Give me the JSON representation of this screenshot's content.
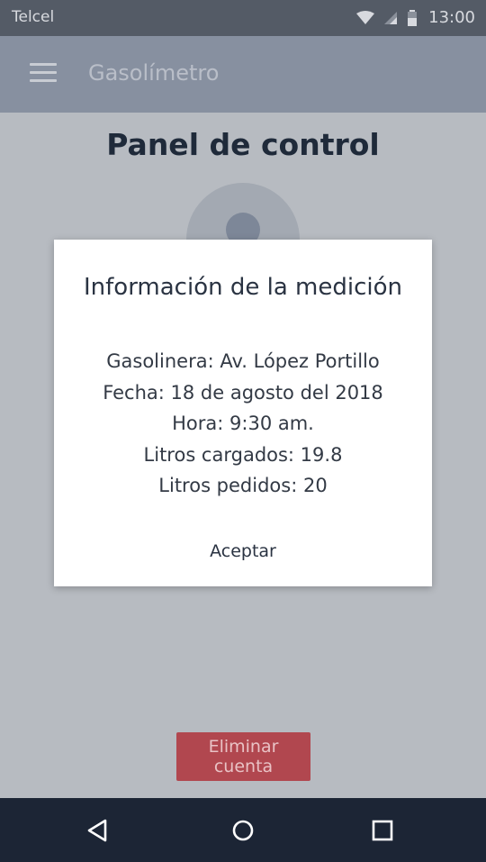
{
  "status_bar": {
    "carrier": "Telcel",
    "time": "13:00",
    "icons": [
      "wifi-icon",
      "signal-icon",
      "battery-icon"
    ]
  },
  "app_bar": {
    "title": "Gasolímetro",
    "menu_icon": "hamburger-menu-icon"
  },
  "main": {
    "page_title": "Panel de control",
    "delete_account_label": "Eliminar cuenta"
  },
  "dialog": {
    "title": "Información de la medición",
    "lines": {
      "gas_station": "Gasolinera: Av. López Portillo",
      "date": "Fecha: 18 de agosto del 2018",
      "time": "Hora: 9:30 am.",
      "liters_loaded": "Litros cargados: 19.8",
      "liters_ordered": "Litros pedidos: 20"
    },
    "accept_label": "Aceptar"
  },
  "nav_bar": {
    "icons": [
      "back-icon",
      "home-icon",
      "recents-icon"
    ]
  },
  "colors": {
    "status_bar": "#545b66",
    "app_bar": "#8790a0",
    "scrim_background": "#b7bbc1",
    "delete_button": "#b1474f",
    "nav_bar": "#1c2535",
    "dialog_background": "#ffffff"
  }
}
